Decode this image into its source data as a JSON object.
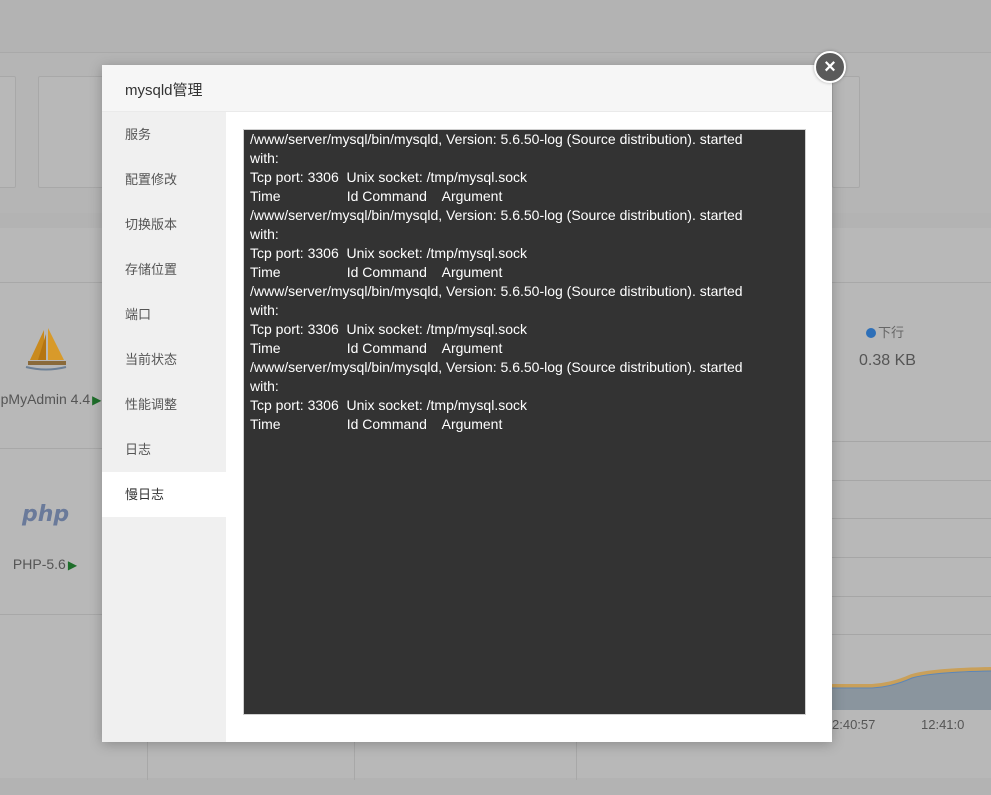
{
  "modal": {
    "title": "mysqld管理",
    "close_symbol": "×"
  },
  "sidebar": {
    "items": [
      {
        "label": "服务"
      },
      {
        "label": "配置修改"
      },
      {
        "label": "切换版本"
      },
      {
        "label": "存储位置"
      },
      {
        "label": "端口"
      },
      {
        "label": "当前状态"
      },
      {
        "label": "性能调整"
      },
      {
        "label": "日志"
      },
      {
        "label": "慢日志",
        "active": true
      }
    ]
  },
  "console": {
    "lines": [
      "/www/server/mysql/bin/mysqld, Version: 5.6.50-log (Source distribution). started",
      "with:",
      "Tcp port: 3306  Unix socket: /tmp/mysql.sock",
      "Time                 Id Command    Argument",
      "/www/server/mysql/bin/mysqld, Version: 5.6.50-log (Source distribution). started",
      "with:",
      "Tcp port: 3306  Unix socket: /tmp/mysql.sock",
      "Time                 Id Command    Argument",
      "/www/server/mysql/bin/mysqld, Version: 5.6.50-log (Source distribution). started",
      "with:",
      "Tcp port: 3306  Unix socket: /tmp/mysql.sock",
      "Time                 Id Command    Argument",
      "/www/server/mysql/bin/mysqld, Version: 5.6.50-log (Source distribution). started",
      "with:",
      "Tcp port: 3306  Unix socket: /tmp/mysql.sock",
      "Time                 Id Command    Argument"
    ]
  },
  "background": {
    "apps": [
      {
        "name": "pMyAdmin 4.4",
        "play": "▶"
      },
      {
        "name": "PHP-5.6",
        "play": "▶",
        "logo": "php"
      }
    ],
    "traffic": {
      "legend": "下行",
      "value": "0.38 KB"
    },
    "times": [
      "2:40:57",
      "12:41:0"
    ]
  },
  "colors": {
    "console_bg": "#333333",
    "sidebar_bg": "#f0f0f0",
    "header_bg": "#f6f6f6",
    "overlay": "#b3b3b3"
  }
}
